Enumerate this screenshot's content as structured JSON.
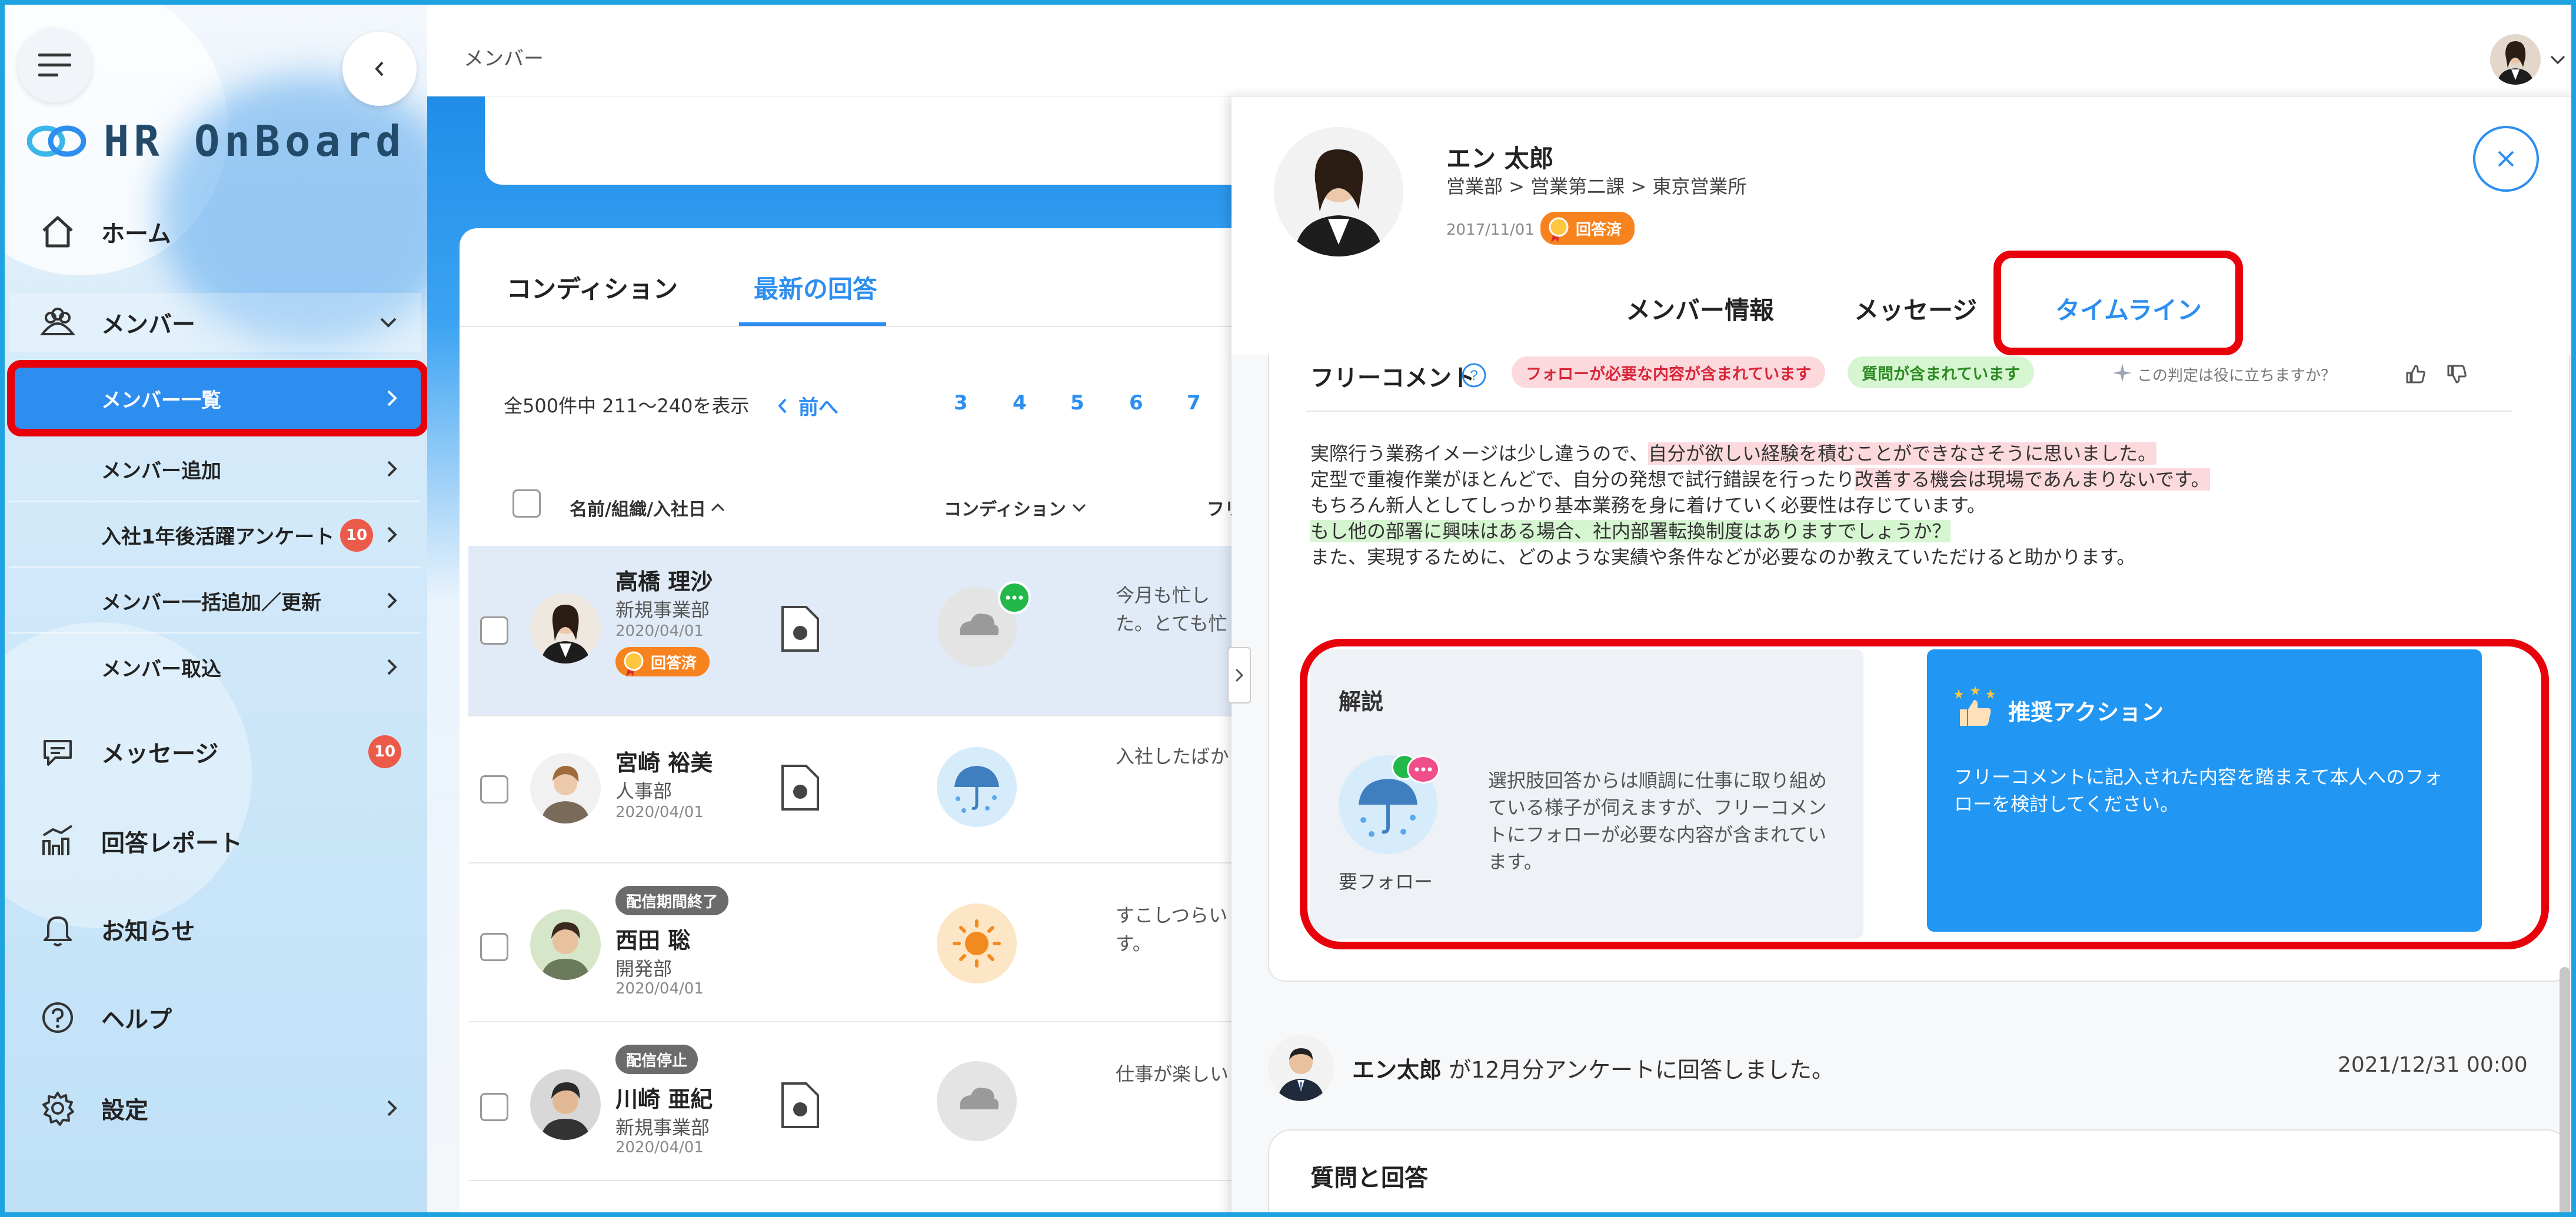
{
  "sidebar": {
    "logo_text": "HR OnBoard",
    "nav": {
      "home": "ホーム",
      "member": "メンバー",
      "member_list": "メンバー一覧",
      "member_add": "メンバー追加",
      "survey": "入社1年後活躍アンケート",
      "survey_badge": "10",
      "bulk": "メンバー一括追加／更新",
      "import": "メンバー取込",
      "message": "メッセージ",
      "message_badge": "10",
      "report": "回答レポート",
      "notice": "お知らせ",
      "help": "ヘルプ",
      "settings": "設定"
    }
  },
  "header": {
    "breadcrumb": "メンバー"
  },
  "list": {
    "tabs": [
      "コンディション",
      "最新の回答"
    ],
    "count_text": "全500件中 211〜240を表示",
    "pagination": {
      "prev": "前へ",
      "pages": [
        "3",
        "4",
        "5",
        "6",
        "7"
      ]
    },
    "columns": [
      "名前/組織/入社日",
      "コンディション",
      "フリ"
    ],
    "rows": [
      {
        "name": "高橋 理沙",
        "dept": "新規事業部",
        "date": "2020/04/01",
        "status": "回答済",
        "comment": "今月も忙し\nた。とても忙"
      },
      {
        "name": "宮崎 裕美",
        "dept": "人事部",
        "date": "2020/04/01",
        "comment": "入社したばか"
      },
      {
        "tag": "配信期間終了",
        "name": "西田 聡",
        "dept": "開発部",
        "date": "2020/04/01",
        "comment": "すこしつらい\nす。"
      },
      {
        "tag": "配信停止",
        "name": "川崎 亜紀",
        "dept": "新規事業部",
        "date": "2020/04/01",
        "comment": "仕事が楽しい"
      }
    ]
  },
  "panel": {
    "name": "エン 太郎",
    "dept": "営業部 > 営業第二課 > 東京営業所",
    "date": "2017/11/01",
    "status": "回答済",
    "tabs": {
      "info": "メンバー情報",
      "message": "メッセージ",
      "timeline": "タイムライン"
    },
    "free_comment": {
      "title": "フリーコメント",
      "pill_follow": "フォローが必要な内容が含まれています",
      "pill_question": "質問が含まれています",
      "helpful": "この判定は役に立ちますか？",
      "lines": [
        {
          "plain": "実際行う業務イメージは少し違うので、",
          "red": "自分が欲しい経験を積むことができなさそうに思いました。"
        },
        {
          "plain": "定型で重複作業がほとんどで、自分の発想で試行錯誤を行ったり",
          "red": "改善する機会は現場であんまりないです。"
        },
        {
          "plain": "もちろん新人としてしっかり基本業務を身に着けていく必要性は存じています。"
        },
        {
          "green": "もし他の部署に興味はある場合、社内部署転換制度はありますでしょうか？"
        },
        {
          "plain": "また、実現するために、どのような実績や条件などが必要なのか教えていただけると助かります。"
        }
      ]
    },
    "explanation": {
      "title": "解説",
      "icon_label": "要フォロー",
      "text": "選択肢回答からは順調に仕事に取り組めている様子が伺えますが、フリーコメントにフォローが必要な内容が含まれています。"
    },
    "action": {
      "title": "推奨アクション",
      "text": "フリーコメントに記入された内容を踏まえて本人へのフォローを検討してください。"
    },
    "timeline": {
      "author": "エン太郎",
      "text": "が12月分アンケートに回答しました。",
      "time": "2021/12/31 00:00"
    },
    "qa_title": "質問と回答"
  },
  "colors": {
    "accent": "#2d8ef0",
    "highlight_red": "#e8000b",
    "action_bg": "#2196f3",
    "status_orange": "#f7831f"
  }
}
